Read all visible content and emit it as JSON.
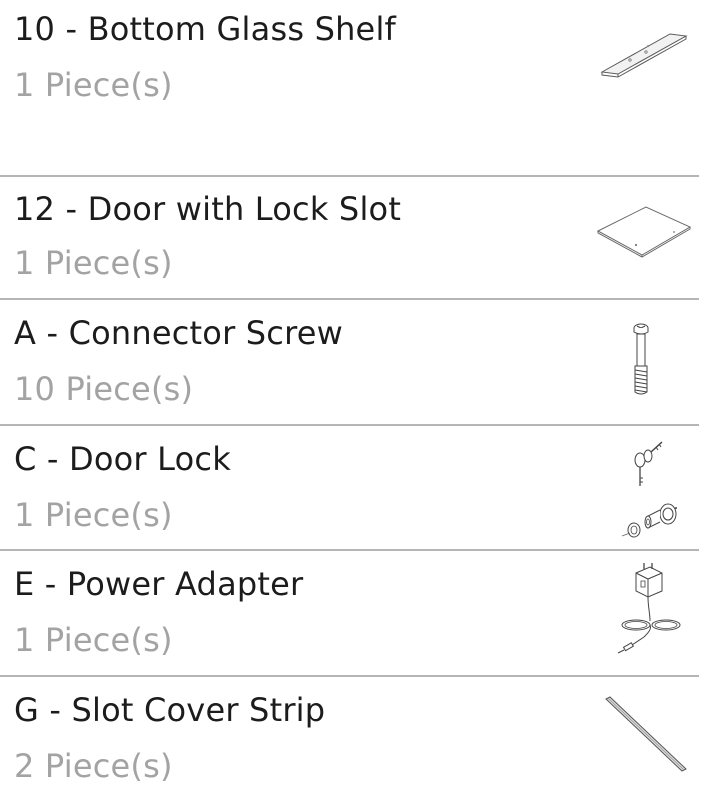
{
  "parts": [
    {
      "name": "10 - Bottom Glass Shelf",
      "quantity": "1 Piece(s)",
      "icon": "glass-shelf-icon"
    },
    {
      "name": "12 - Door with Lock Slot",
      "quantity": "1 Piece(s)",
      "icon": "door-panel-icon"
    },
    {
      "name": "A - Connector Screw",
      "quantity": "10 Piece(s)",
      "icon": "connector-screw-icon"
    },
    {
      "name": "C - Door Lock",
      "quantity": "1 Piece(s)",
      "icon": "door-lock-icon"
    },
    {
      "name": "E - Power Adapter",
      "quantity": "1 Piece(s)",
      "icon": "power-adapter-icon"
    },
    {
      "name": "G - Slot Cover Strip",
      "quantity": "2 Piece(s)",
      "icon": "cover-strip-icon"
    }
  ],
  "colors": {
    "name_text": "#1c1c1c",
    "quantity_text": "#a3a3a3",
    "divider": "#b5b5b5"
  }
}
